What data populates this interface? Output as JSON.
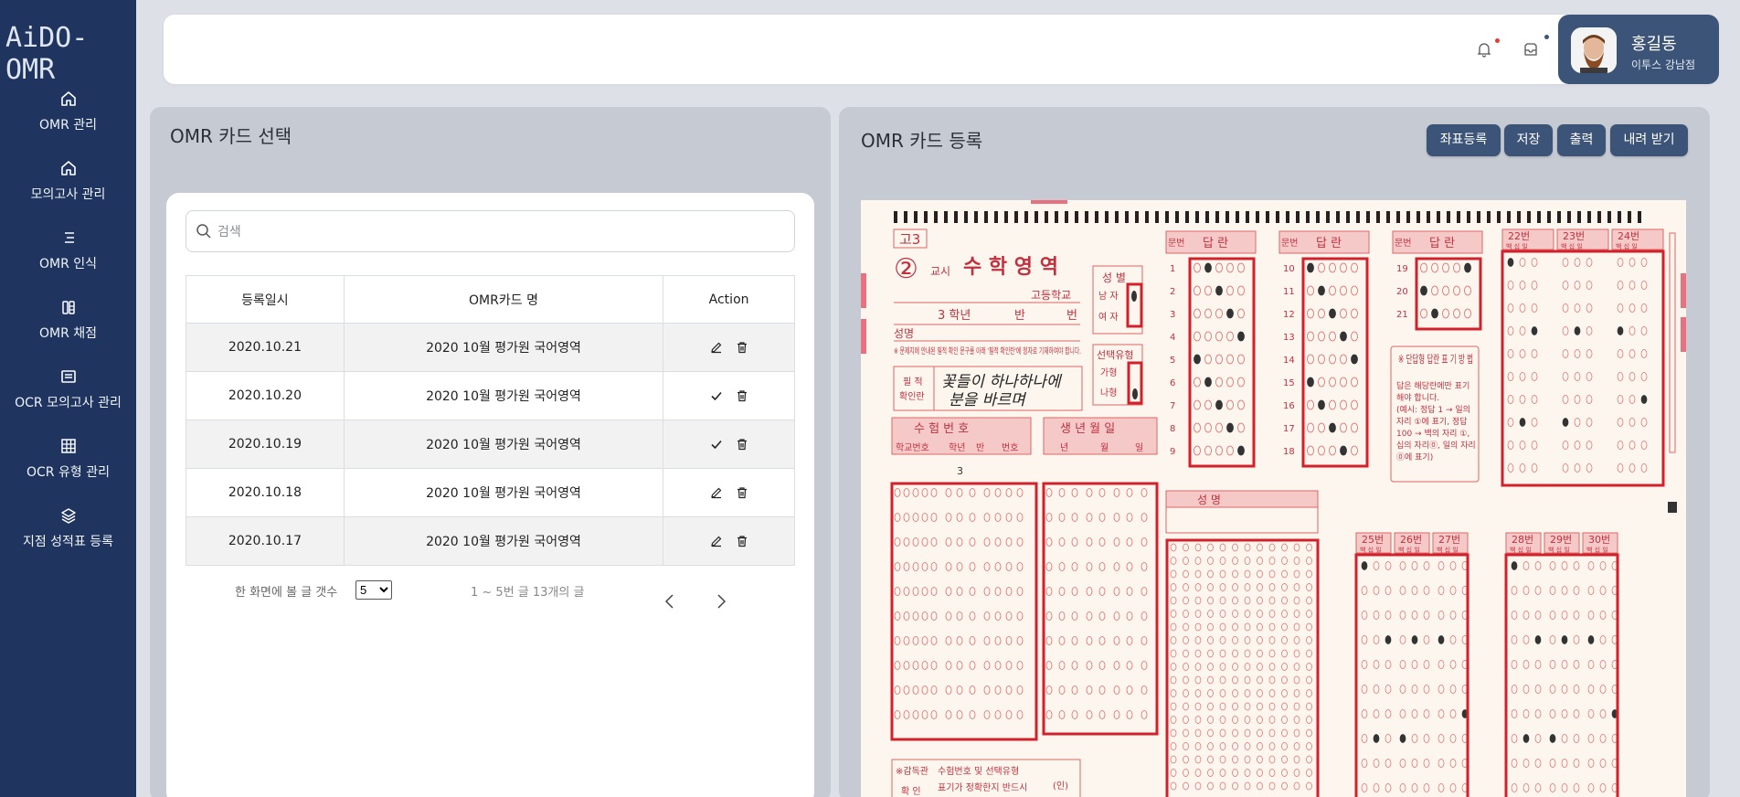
{
  "app": {
    "logo_text": "AiDO-OMR",
    "logo_subtext": ""
  },
  "sidebar": {
    "items": [
      {
        "label": "OMR 관리",
        "icon": "home-icon"
      },
      {
        "label": "모의고사 관리",
        "icon": "home-icon"
      },
      {
        "label": "OMR 인식",
        "icon": "list-icon"
      },
      {
        "label": "OMR 채점",
        "icon": "clipboard-icon"
      },
      {
        "label": "OCR 모의고사 관리",
        "icon": "card-icon"
      },
      {
        "label": "OCR 유형 관리",
        "icon": "grid-icon"
      },
      {
        "label": "지점 성적표 등록",
        "icon": "layers-icon"
      }
    ]
  },
  "header": {
    "user_name": "홍길동",
    "user_branch": "이투스 강남점",
    "notification_dot_color": "#e53935",
    "inbox_dot_color": "#3c5478"
  },
  "left_panel": {
    "title": "OMR 카드 선택",
    "search_placeholder": "검색",
    "columns": [
      "등록일시",
      "OMR카드 명",
      "Action"
    ],
    "rows": [
      {
        "date": "2020.10.21",
        "name": "2020 10월 평가원 국어영역",
        "action": "edit"
      },
      {
        "date": "2020.10.20",
        "name": "2020 10월 평가원 국어영역",
        "action": "check"
      },
      {
        "date": "2020.10.19",
        "name": "2020 10월 평가원 국어영역",
        "action": "check"
      },
      {
        "date": "2020.10.18",
        "name": "2020 10월 평가원 국어영역",
        "action": "edit"
      },
      {
        "date": "2020.10.17",
        "name": "2020 10월 평가원 국어영역",
        "action": "edit"
      }
    ],
    "per_page_label": "한 화면에 볼 글 갯수",
    "per_page_value": "5",
    "page_info": "1 ~ 5번 글 13개의 글"
  },
  "right_panel": {
    "title": "OMR 카드 등록",
    "buttons": [
      "좌표등록",
      "저장",
      "출력",
      "내려 받기"
    ]
  },
  "omr_sheet": {
    "grade": "고3",
    "period_number": "②",
    "period_label": "교시",
    "subject": "수 학 영 역",
    "school_label": "고등학교",
    "class_row": [
      "3 학년",
      "반",
      "번"
    ],
    "name_label": "성명",
    "notice": "※ 문제지에 안내된 필적 확인 문구를 아래 '필적 확인란'에 정자로 기재하여야 합니다.",
    "handwriting_label": [
      "필 적",
      "확인란"
    ],
    "handwriting_text": [
      "꽃들이 하나하나에",
      "분을 바르며"
    ],
    "gender_title": "성 별",
    "gender_options": [
      "남 자",
      "여 자"
    ],
    "type_title": "선택유형",
    "type_options": [
      "가형",
      "나형"
    ],
    "exam_number_title": "수 험 번 호",
    "exam_number_cols": [
      "학교번호",
      "학년",
      "반",
      "번호"
    ],
    "exam_number_grade_value": "3",
    "birth_title": "생 년 월 일",
    "birth_cols": [
      "년",
      "월",
      "일"
    ],
    "name_box_title": "성 명",
    "answer_headers": [
      "문번",
      "답 란"
    ],
    "answer_cols": [
      {
        "start": 1,
        "end": 9
      },
      {
        "start": 10,
        "end": 18
      },
      {
        "start": 19,
        "end": 21
      }
    ],
    "short_answer_title": "※ 단답형 답란 표 기 방 법",
    "short_answer_text": [
      "답은 해당란에만 표기",
      "해야 합니다.",
      "(예시: 정답 1 → 일의",
      "자리 ①에 표기, 정답",
      "100 → 백의 자리 ①,",
      "십의 자리⓪, 일의 자리",
      "⓪에 표기)"
    ],
    "short_answer_numbers_top": [
      "22번",
      "23번",
      "24번"
    ],
    "short_answer_numbers_bottom_a": [
      "25번",
      "26번",
      "27번"
    ],
    "short_answer_numbers_bottom_b": [
      "28번",
      "29번",
      "30번"
    ],
    "place_label": "백 십 일",
    "proctor_label": [
      "※감독관",
      "확 인"
    ],
    "proctor_text": [
      "수험번호 및 선택유형",
      "표기가 정확한지 반드시"
    ],
    "seal_label": "(인)"
  }
}
